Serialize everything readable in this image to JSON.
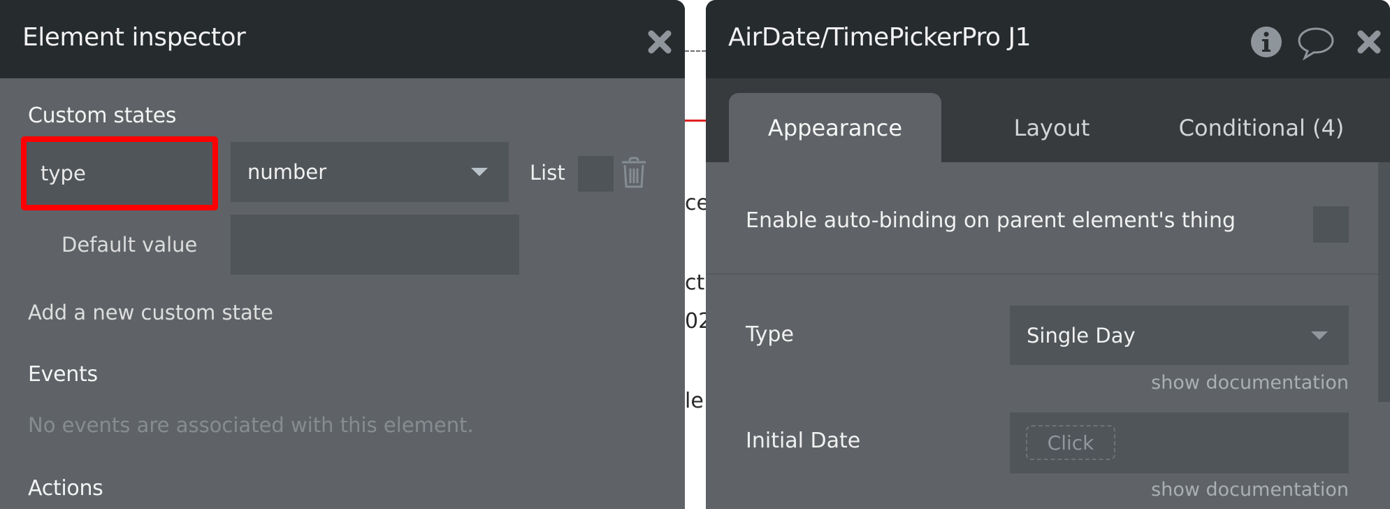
{
  "canvas": {
    "fragments": [
      "ce",
      "cte",
      "02",
      "le"
    ]
  },
  "element_inspector": {
    "title": "Element inspector",
    "close_icon": "close-icon",
    "custom_states": {
      "heading": "Custom states",
      "state_name": "type",
      "state_type": "number",
      "list_label": "List",
      "list_checked": false,
      "default_value_label": "Default value",
      "default_value": "",
      "add_link": "Add a new custom state"
    },
    "events": {
      "heading": "Events",
      "empty_message": "No events are associated with this element."
    },
    "actions": {
      "heading": "Actions"
    },
    "highlight_color": "#ff0000"
  },
  "property_editor": {
    "title": "AirDate/TimePickerPro J1",
    "icons": [
      "info-icon",
      "comment-icon",
      "close-icon"
    ],
    "tabs": [
      {
        "label": "Appearance",
        "active": true
      },
      {
        "label": "Layout",
        "active": false
      },
      {
        "label": "Conditional (4)",
        "active": false
      }
    ],
    "autobinding": {
      "label": "Enable auto-binding on parent element's thing",
      "checked": false
    },
    "fields": [
      {
        "label": "Type",
        "value": "Single Day",
        "doc_link": "show documentation"
      },
      {
        "label": "Initial Date",
        "button": "Click",
        "doc_link": "show documentation"
      }
    ]
  }
}
